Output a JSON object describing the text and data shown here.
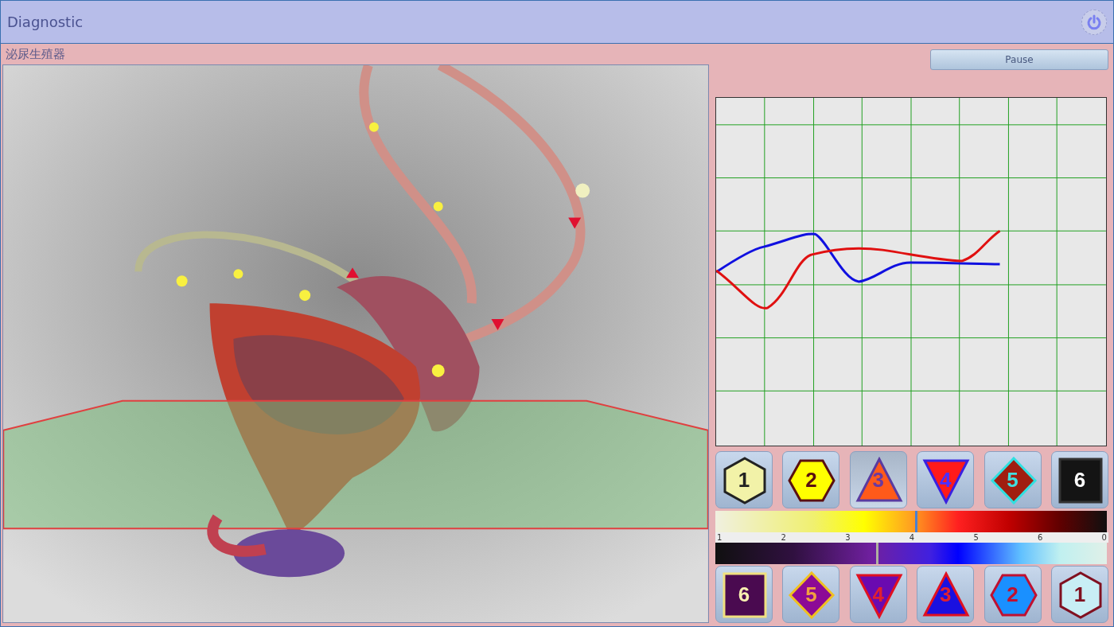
{
  "window": {
    "title": "Diagnostic"
  },
  "section_title": "泌尿生殖器",
  "pause_button": {
    "label": "Pause"
  },
  "top_buttons": [
    {
      "label": "1",
      "kind": "hexagon",
      "color": "#f2f2a8",
      "selected": false
    },
    {
      "label": "2",
      "kind": "wide-hexagon",
      "color": "#ffff00",
      "selected": false
    },
    {
      "label": "3",
      "kind": "triangle",
      "color": "#ff5a1a",
      "selected": true
    },
    {
      "label": "4",
      "kind": "inverted-triangle",
      "color": "#ff1a1a",
      "selected": false
    },
    {
      "label": "5",
      "kind": "diamond",
      "color": "#a01e10",
      "selected": false
    },
    {
      "label": "6",
      "kind": "square",
      "color": "#141414",
      "selected": false
    }
  ],
  "spectrum": {
    "warm": {
      "level": 0.51
    },
    "cool": {
      "level": 0.41
    },
    "scale": [
      "1",
      "2",
      "3",
      "4",
      "5",
      "6",
      "0"
    ]
  },
  "bottom_buttons": [
    {
      "label": "6",
      "kind": "square",
      "color": "#4a0a50",
      "selected": false
    },
    {
      "label": "5",
      "kind": "diamond",
      "color": "#8c0a96",
      "selected": false
    },
    {
      "label": "4",
      "kind": "inverted-triangle",
      "color": "#6a0ab0",
      "selected": false
    },
    {
      "label": "3",
      "kind": "triangle",
      "color": "#1a10e0",
      "selected": false
    },
    {
      "label": "2",
      "kind": "wide-hexagon",
      "color": "#1a90ff",
      "selected": false
    },
    {
      "label": "1",
      "kind": "hexagon",
      "color": "#c8eef5",
      "selected": false
    }
  ]
}
